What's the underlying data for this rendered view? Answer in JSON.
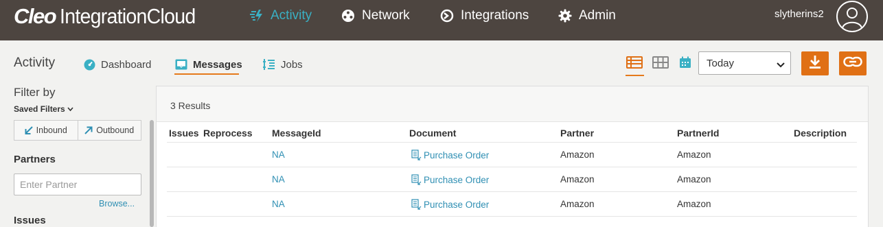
{
  "app": {
    "brand_bold": "Cleo",
    "brand_rest": "IntegrationCloud"
  },
  "topnav": [
    {
      "label": "Activity",
      "icon": "activity-icon",
      "active": true
    },
    {
      "label": "Network",
      "icon": "network-icon",
      "active": false
    },
    {
      "label": "Integrations",
      "icon": "integrations-icon",
      "active": false
    },
    {
      "label": "Admin",
      "icon": "gear-icon",
      "active": false
    }
  ],
  "user": {
    "name": "slytherins2",
    "avatar_icon": "user-avatar-icon"
  },
  "subnav": {
    "title": "Activity",
    "tabs": [
      {
        "label": "Dashboard",
        "icon": "dashboard-icon",
        "active": false
      },
      {
        "label": "Messages",
        "icon": "messages-icon",
        "active": true
      },
      {
        "label": "Jobs",
        "icon": "jobs-icon",
        "active": false
      }
    ]
  },
  "view_controls": {
    "views": [
      "list-view-icon",
      "grid-view-icon",
      "calendar-icon"
    ],
    "active_view": "list-view-icon",
    "date_range": "Today",
    "download_icon": "download-icon",
    "link_icon": "link-icon"
  },
  "filters": {
    "title": "Filter by",
    "saved_filters": "Saved Filters",
    "inbound": "Inbound",
    "outbound": "Outbound",
    "partners_label": "Partners",
    "partner_placeholder": "Enter Partner",
    "browse": "Browse...",
    "issues_label": "Issues"
  },
  "results": {
    "count_text": "3 Results",
    "columns": [
      "Issues",
      "Reprocess",
      "MessageId",
      "Document",
      "Partner",
      "PartnerId",
      "Description"
    ],
    "rows": [
      {
        "issues": "",
        "reprocess": "",
        "message_id": "NA",
        "document": "Purchase Order",
        "partner": "Amazon",
        "partner_id": "Amazon",
        "description": ""
      },
      {
        "issues": "",
        "reprocess": "",
        "message_id": "NA",
        "document": "Purchase Order",
        "partner": "Amazon",
        "partner_id": "Amazon",
        "description": ""
      },
      {
        "issues": "",
        "reprocess": "",
        "message_id": "NA",
        "document": "Purchase Order",
        "partner": "Amazon",
        "partner_id": "Amazon",
        "description": ""
      }
    ]
  },
  "colors": {
    "topbar": "#4d4540",
    "accent": "#3ab0c4",
    "orange": "#e07015",
    "link": "#2f8fb3"
  }
}
